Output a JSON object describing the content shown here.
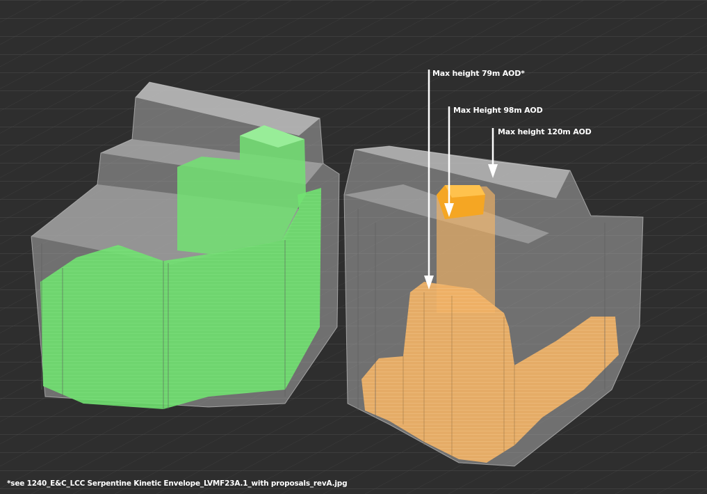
{
  "annotations": {
    "label_79": "Max height 79m AOD*",
    "label_98": "Max Height 98m AOD",
    "label_120": "Max height 120m AOD"
  },
  "footnote": "*see 1240_E&C_LCC Serpentine Kinetic Envelope_LVMF23A.1_with proposals_revA.jpg",
  "colors": {
    "background": "#2e2e2e",
    "grid": "#4a4a4a",
    "envelope": "#c8c8c8",
    "green_massing": "#6fe06f",
    "orange_massing": "#f2b366",
    "orange_top": "#f5a623",
    "arrow": "#ffffff"
  }
}
